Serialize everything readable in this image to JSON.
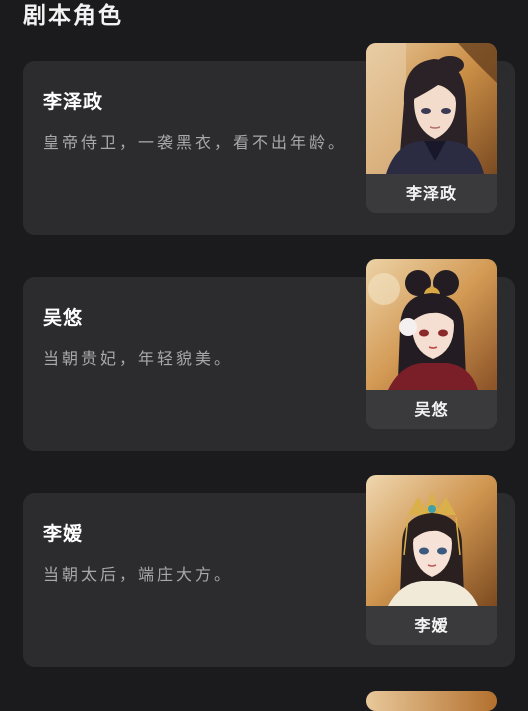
{
  "page": {
    "section_title": "剧本角色"
  },
  "roles": [
    {
      "name": "李泽政",
      "description": "皇帝侍卫，一袭黑衣，看不出年龄。",
      "portrait_label": "李泽政",
      "portrait_icon": "character-portrait-guard"
    },
    {
      "name": "吴悠",
      "description": "当朝贵妃，年轻貌美。",
      "portrait_label": "吴悠",
      "portrait_icon": "character-portrait-consort"
    },
    {
      "name": "李嫒",
      "description": "当朝太后，端庄大方。",
      "portrait_label": "李嫒",
      "portrait_icon": "character-portrait-empress-dowager"
    }
  ],
  "colors": {
    "background": "#1b1b1d",
    "card": "#2c2c2f",
    "portrait_label_bg": "#3a3a3d",
    "name_text": "#ffffff",
    "desc_text": "#a8a8ab",
    "portrait_bg_warm": "#c98d45"
  }
}
